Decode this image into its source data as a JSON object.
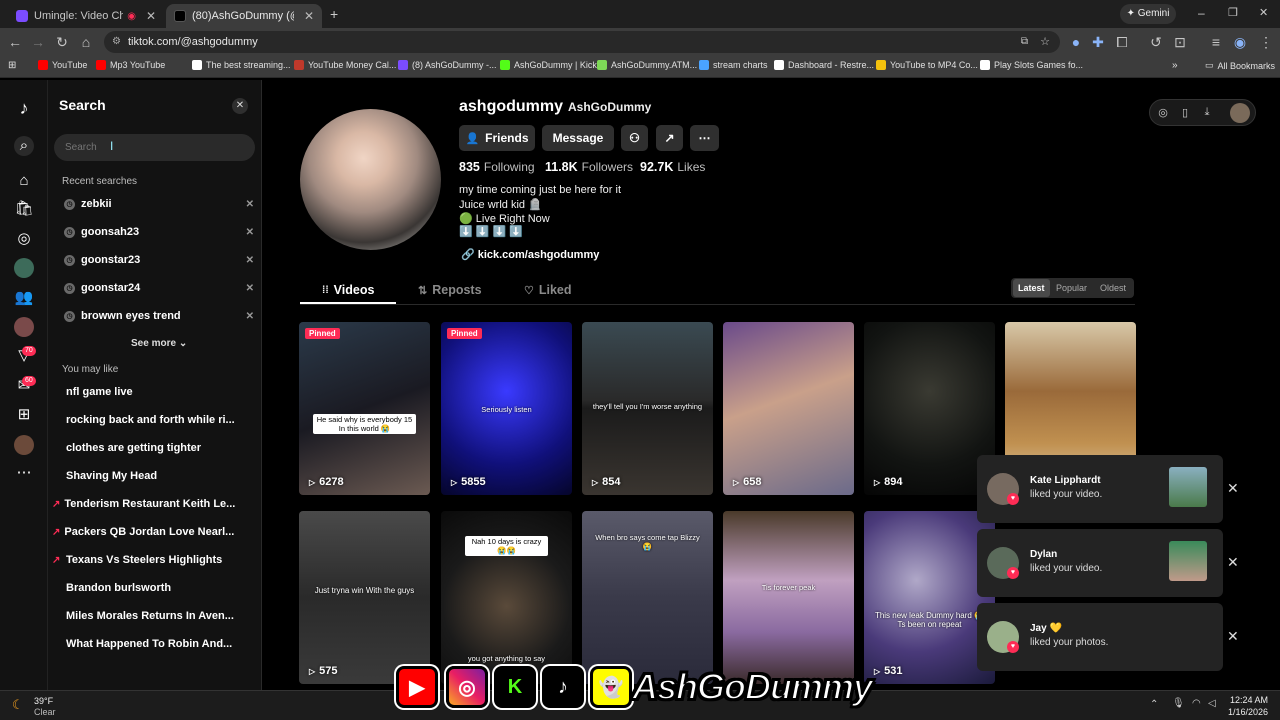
{
  "browser": {
    "tabs": [
      {
        "title": "Umingle: Video Chat with S",
        "active": false
      },
      {
        "title": "(80)AshGoDummy (@ashgodu",
        "active": true
      }
    ],
    "gemini_label": "Gemini",
    "url": "tiktok.com/@ashgodummy",
    "bookmarks": [
      "YouTube",
      "Mp3 YouTube",
      "The best streaming...",
      "YouTube Money Cal...",
      "(8) AshGoDummy -...",
      "AshGoDummy | Kick",
      "AshGoDummy.ATM...",
      "stream charts",
      "Dashboard - Restre...",
      "YouTube to MP4 Co...",
      "Play Slots Games fo..."
    ],
    "all_bookmarks": "All Bookmarks"
  },
  "rail": {
    "badge_a": "70",
    "badge_b": "60"
  },
  "search": {
    "title": "Search",
    "placeholder": "Search",
    "recent_label": "Recent searches",
    "recent": [
      "zebkii",
      "goonsah23",
      "goonstar23",
      "goonstar24",
      "browwn eyes trend"
    ],
    "see_more": "See more",
    "may_like_label": "You may like",
    "suggestions": [
      {
        "text": "nfl game live",
        "trending": false
      },
      {
        "text": "rocking back and forth while ri...",
        "trending": false
      },
      {
        "text": "clothes are getting tighter",
        "trending": false
      },
      {
        "text": "Shaving My Head",
        "trending": false
      },
      {
        "text": "Tenderism Restaurant Keith Le...",
        "trending": true
      },
      {
        "text": "Packers QB Jordan Love Nearl...",
        "trending": true
      },
      {
        "text": "Texans Vs Steelers Highlights",
        "trending": true
      },
      {
        "text": "Brandon burlsworth",
        "trending": false
      },
      {
        "text": "Miles Morales Returns In Aven...",
        "trending": false
      },
      {
        "text": "What Happened To Robin And...",
        "trending": false
      }
    ]
  },
  "profile": {
    "username": "ashgodummy",
    "display_name": "AshGoDummy",
    "buttons": {
      "friends": "Friends",
      "message": "Message"
    },
    "stats": {
      "following_count": "835",
      "following_label": "Following",
      "followers_count": "11.8K",
      "followers_label": "Followers",
      "likes_count": "92.7K",
      "likes_label": "Likes"
    },
    "bio": [
      "my time coming just be here for it",
      "Juice wrld kid 🪦",
      "🟢 Live Right Now",
      "⬇️ ⬇️ ⬇️ ⬇️"
    ],
    "link": "kick.com/ashgodummy",
    "tabs": [
      "Videos",
      "Reposts",
      "Liked"
    ],
    "sort": [
      "Latest",
      "Popular",
      "Oldest"
    ]
  },
  "videos": [
    {
      "views": "6278",
      "pinned": "Pinned",
      "caption": "He said why is everybody 15 In this world 😭"
    },
    {
      "views": "5855",
      "pinned": "Pinned",
      "caption": "Seriously listen"
    },
    {
      "views": "854",
      "pinned": "",
      "caption": "they'll tell you I'm worse anything"
    },
    {
      "views": "658",
      "pinned": "",
      "caption": ""
    },
    {
      "views": "894",
      "pinned": "",
      "caption": ""
    },
    {
      "views": "",
      "pinned": "",
      "caption": ""
    },
    {
      "views": "575",
      "pinned": "",
      "caption": "Just tryna win With the guys"
    },
    {
      "views": "",
      "pinned": "",
      "caption": "Nah 10 days is crazy 😭😭"
    },
    {
      "views": "",
      "pinned": "",
      "caption": "When bro says come tap Blizzy 😭"
    },
    {
      "views": "",
      "pinned": "",
      "caption": "Tis forever peak"
    },
    {
      "views": "531",
      "pinned": "",
      "caption": "This new leak Dummy hard 😭 Ts been on repeat"
    }
  ],
  "video_extra_caption": "you got anything to say",
  "notifications": [
    {
      "name": "Kate Lipphardt",
      "text": "liked your video."
    },
    {
      "name": "Dylan",
      "text": "liked your video."
    },
    {
      "name": "Jay 💛",
      "text": "liked your photos."
    }
  ],
  "taskbar": {
    "temp": "39°F",
    "weather": "Clear",
    "time": "12:24 AM",
    "date": "1/16/2026"
  },
  "overlay_brand": "AshGoDummy",
  "colors": {
    "accent": "#fe2c55",
    "background": "#000000",
    "panel": "#121212"
  }
}
